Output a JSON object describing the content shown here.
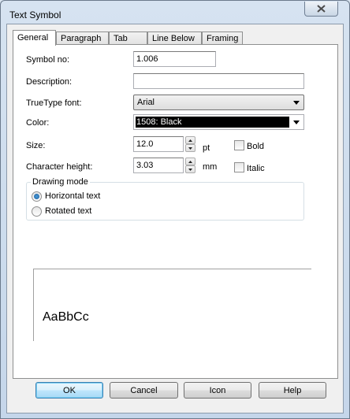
{
  "window": {
    "title": "Text Symbol"
  },
  "tabs": [
    "General",
    "Paragraph",
    "Tab",
    "Line Below",
    "Framing"
  ],
  "active_tab": "General",
  "form": {
    "symbol_no": {
      "label": "Symbol no:",
      "value": "1.006"
    },
    "description": {
      "label": "Description:",
      "value": ""
    },
    "font": {
      "label": "TrueType font:",
      "value": "Arial"
    },
    "color": {
      "label": "Color:",
      "value": "1508: Black",
      "swatch": "#000000"
    },
    "size": {
      "label": "Size:",
      "value": "12.0",
      "unit": "pt"
    },
    "char_height": {
      "label": "Character height:",
      "value": "3.03",
      "unit": "mm"
    },
    "bold": {
      "label": "Bold",
      "checked": false
    },
    "italic": {
      "label": "Italic",
      "checked": false
    }
  },
  "drawing_mode": {
    "legend": "Drawing mode",
    "options": [
      {
        "label": "Horizontal text",
        "checked": true
      },
      {
        "label": "Rotated text",
        "checked": false
      }
    ]
  },
  "preview": {
    "sample": "AaBbCc"
  },
  "buttons": {
    "ok": "OK",
    "cancel": "Cancel",
    "icon": "Icon",
    "help": "Help"
  },
  "colors": {
    "accent": "#3c7fb1",
    "titlebar": "#c5d6ea",
    "radio": "#1c5e9c"
  }
}
